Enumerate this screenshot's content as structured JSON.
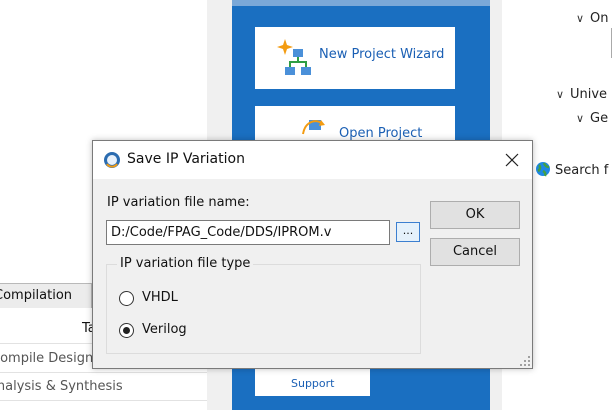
{
  "dialog": {
    "title": "Save IP Variation",
    "file_label": "IP variation file name:",
    "file_value": "D:/Code/FPAG_Code/DDS/IPROM.v",
    "browse_label": "...",
    "ok_label": "OK",
    "cancel_label": "Cancel",
    "group_title": "IP variation file type",
    "options": [
      {
        "label": "VHDL",
        "selected": false
      },
      {
        "label": "Verilog",
        "selected": true
      }
    ]
  },
  "home": {
    "new_project_label": "New Project Wizard",
    "open_project_label": "Open Project",
    "support_label": "Support"
  },
  "right_panel": {
    "row1": "On",
    "row2": "Unive",
    "row3": "Ge",
    "row4": "Search f"
  },
  "left_panel": {
    "tab_label": "Compilation",
    "col_label": "Ta",
    "row1": "Compile Design",
    "row2": "Analysis & Synthesis"
  },
  "colors": {
    "accent_blue": "#1a6fc1",
    "link_blue": "#1a5fb4",
    "dialog_bg": "#f0f0f0"
  },
  "icons": [
    "wizard-icon",
    "open-project-icon",
    "support-icon",
    "globe-icon",
    "dialog-app-icon",
    "close-icon",
    "resize-grip-icon"
  ]
}
